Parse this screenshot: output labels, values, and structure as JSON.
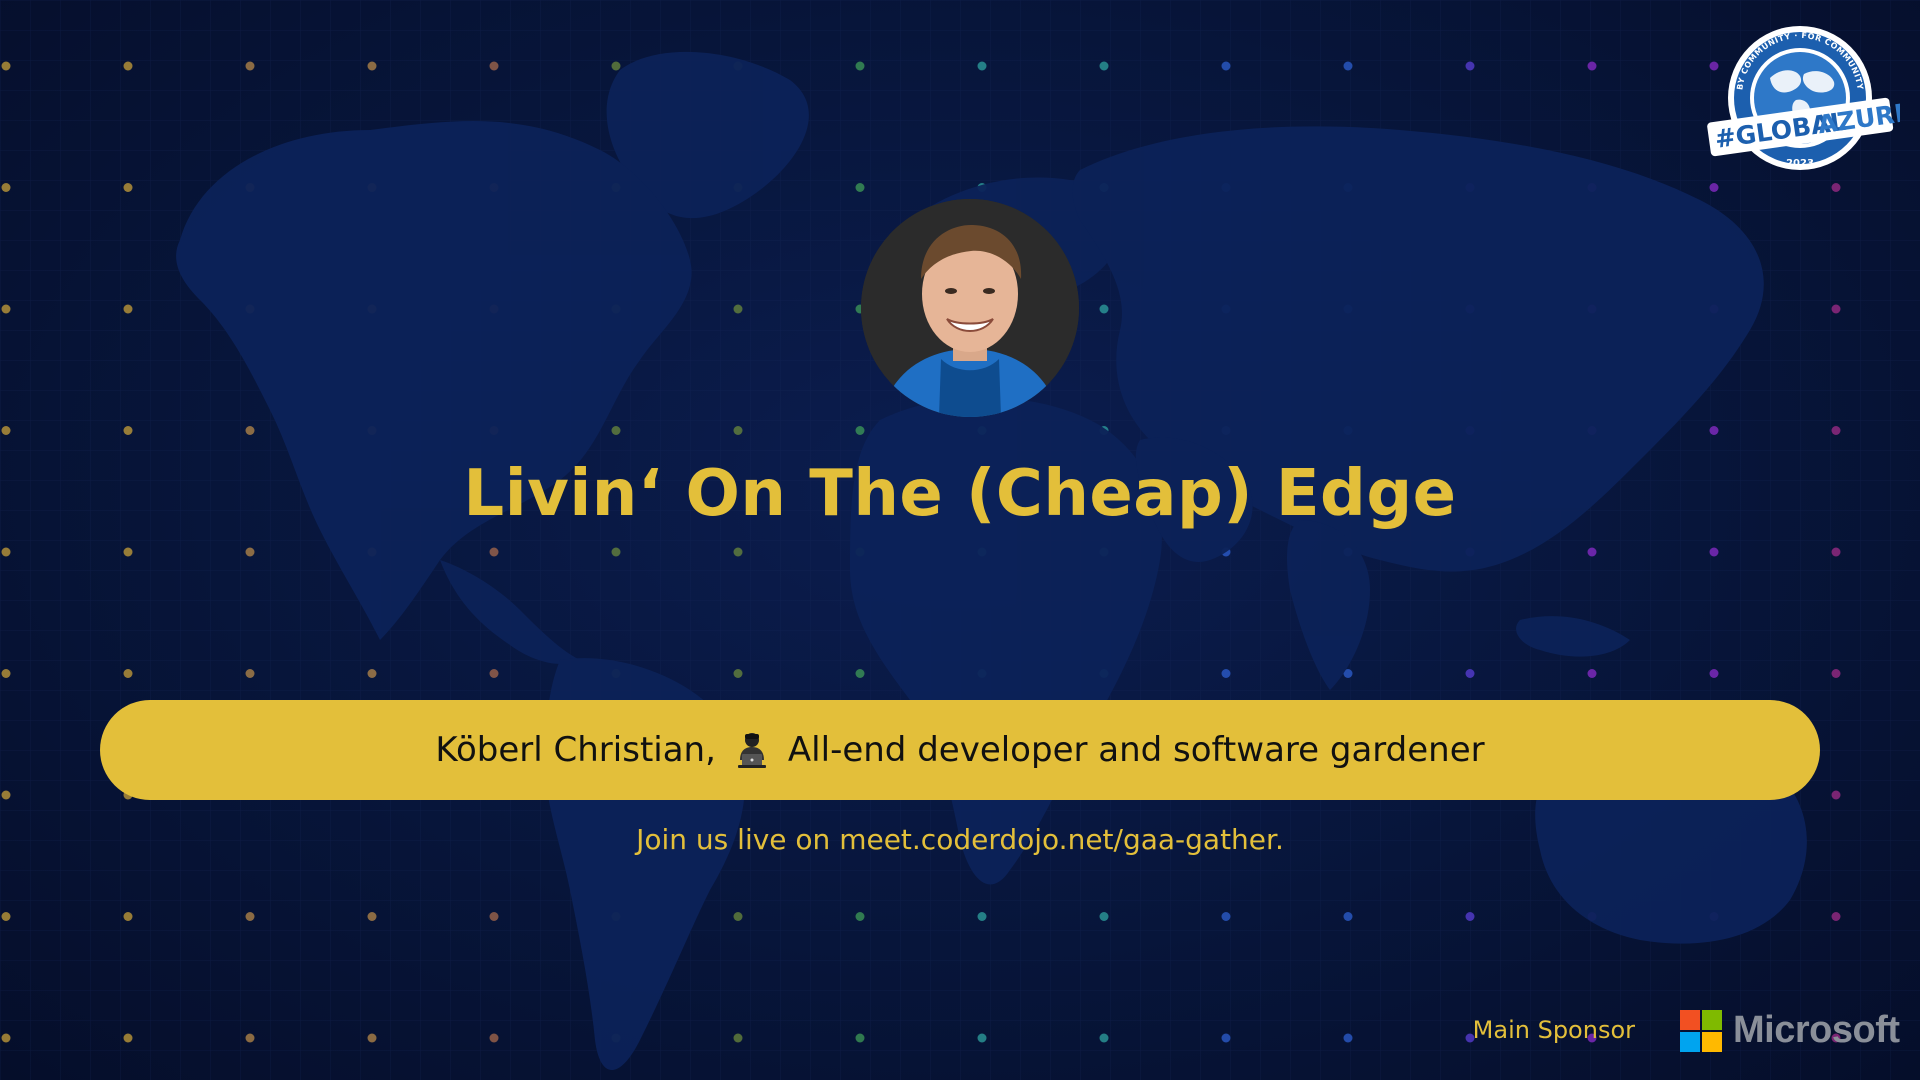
{
  "slide": {
    "title": "Livin‘ On The (Cheap) Edge",
    "speaker_name": "Köberl Christian,",
    "speaker_icon": "technologist-laptop-icon",
    "speaker_role": "All-end developer and software gardener",
    "join_text": "Join us live on meet.coderdojo.net/gaa-gather.",
    "sponsor_label": "Main Sponsor",
    "sponsor_name": "Microsoft"
  },
  "logo": {
    "ring_text": "BY COMMUNITY · FOR COMMUNITY",
    "hashtag": "#GLOBAL",
    "word": "AZURE",
    "year": "2023"
  },
  "colors": {
    "background": "#07153a",
    "accent_yellow": "#e3bf3a",
    "map": "#0c2258",
    "logo_blue": "#1c5fae",
    "ms_red": "#f25022",
    "ms_green": "#7fba00",
    "ms_blue": "#00a4ef",
    "ms_yellow": "#ffb900"
  }
}
